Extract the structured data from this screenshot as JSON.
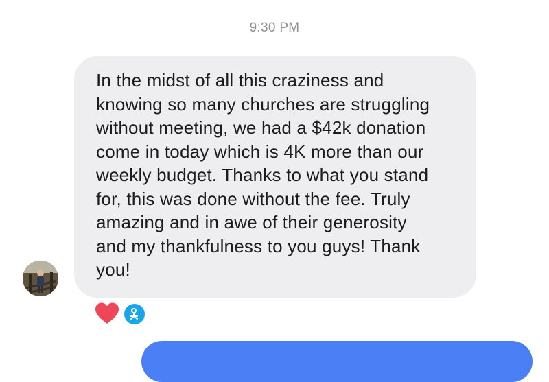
{
  "conversation": {
    "timestamp": "9:30 PM",
    "incoming_message": {
      "text": "In the midst of all this craziness and\nknowing so many churches are struggling\nwithout meeting, we had a $42k donation\ncome in today which is 4K more than our\nweekly budget. Thanks to what you stand\nfor, this was done without the fee. Truly\namazing and in awe of their generosity\nand my thankfulness to you guys! Thank\nyou!",
      "sender_avatar": "user-photo-avatar",
      "reactions": [
        {
          "icon": "heart-icon",
          "color": "#ef4757"
        },
        {
          "icon": "reactor-avatar-icon",
          "color": "#19a6e8"
        }
      ]
    },
    "colors": {
      "incoming_bubble": "#eeeef0",
      "outgoing_bubble": "#4b7ff5",
      "timestamp": "#8e8e93"
    }
  }
}
